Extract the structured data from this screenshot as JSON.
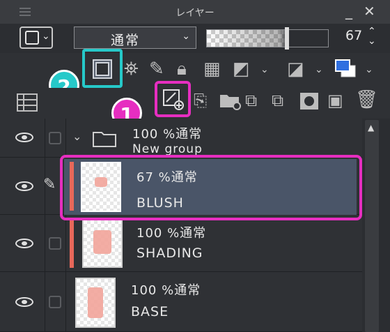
{
  "window": {
    "title": "レイヤー",
    "menu_icon": "hamburger-icon",
    "min_label": "_",
    "close_label": "✕"
  },
  "toolbar_top": {
    "blend_mode": "通常",
    "opacity": "67"
  },
  "annotations": {
    "badge1": "1",
    "badge2": "2",
    "badge1_color": "#e62ec0",
    "badge2_color": "#26c9c9"
  },
  "layers": [
    {
      "name_line1": "100 %通常",
      "name_line2": "New group",
      "type": "group"
    },
    {
      "name_line1": "67 %通常",
      "name_line2": "BLUSH",
      "selected": true
    },
    {
      "name_line1": "100 %通常",
      "name_line2": "SHADING"
    },
    {
      "name_line1": "100 %通常",
      "name_line2": "BASE"
    }
  ],
  "colors": {
    "panel_bg": "#2f3135",
    "selected_row": "#4a5568",
    "accent_red": "#e8685a",
    "highlight_pink": "#e62ec0",
    "highlight_teal": "#26c9c9",
    "color_blue": "#2f6fe0"
  }
}
